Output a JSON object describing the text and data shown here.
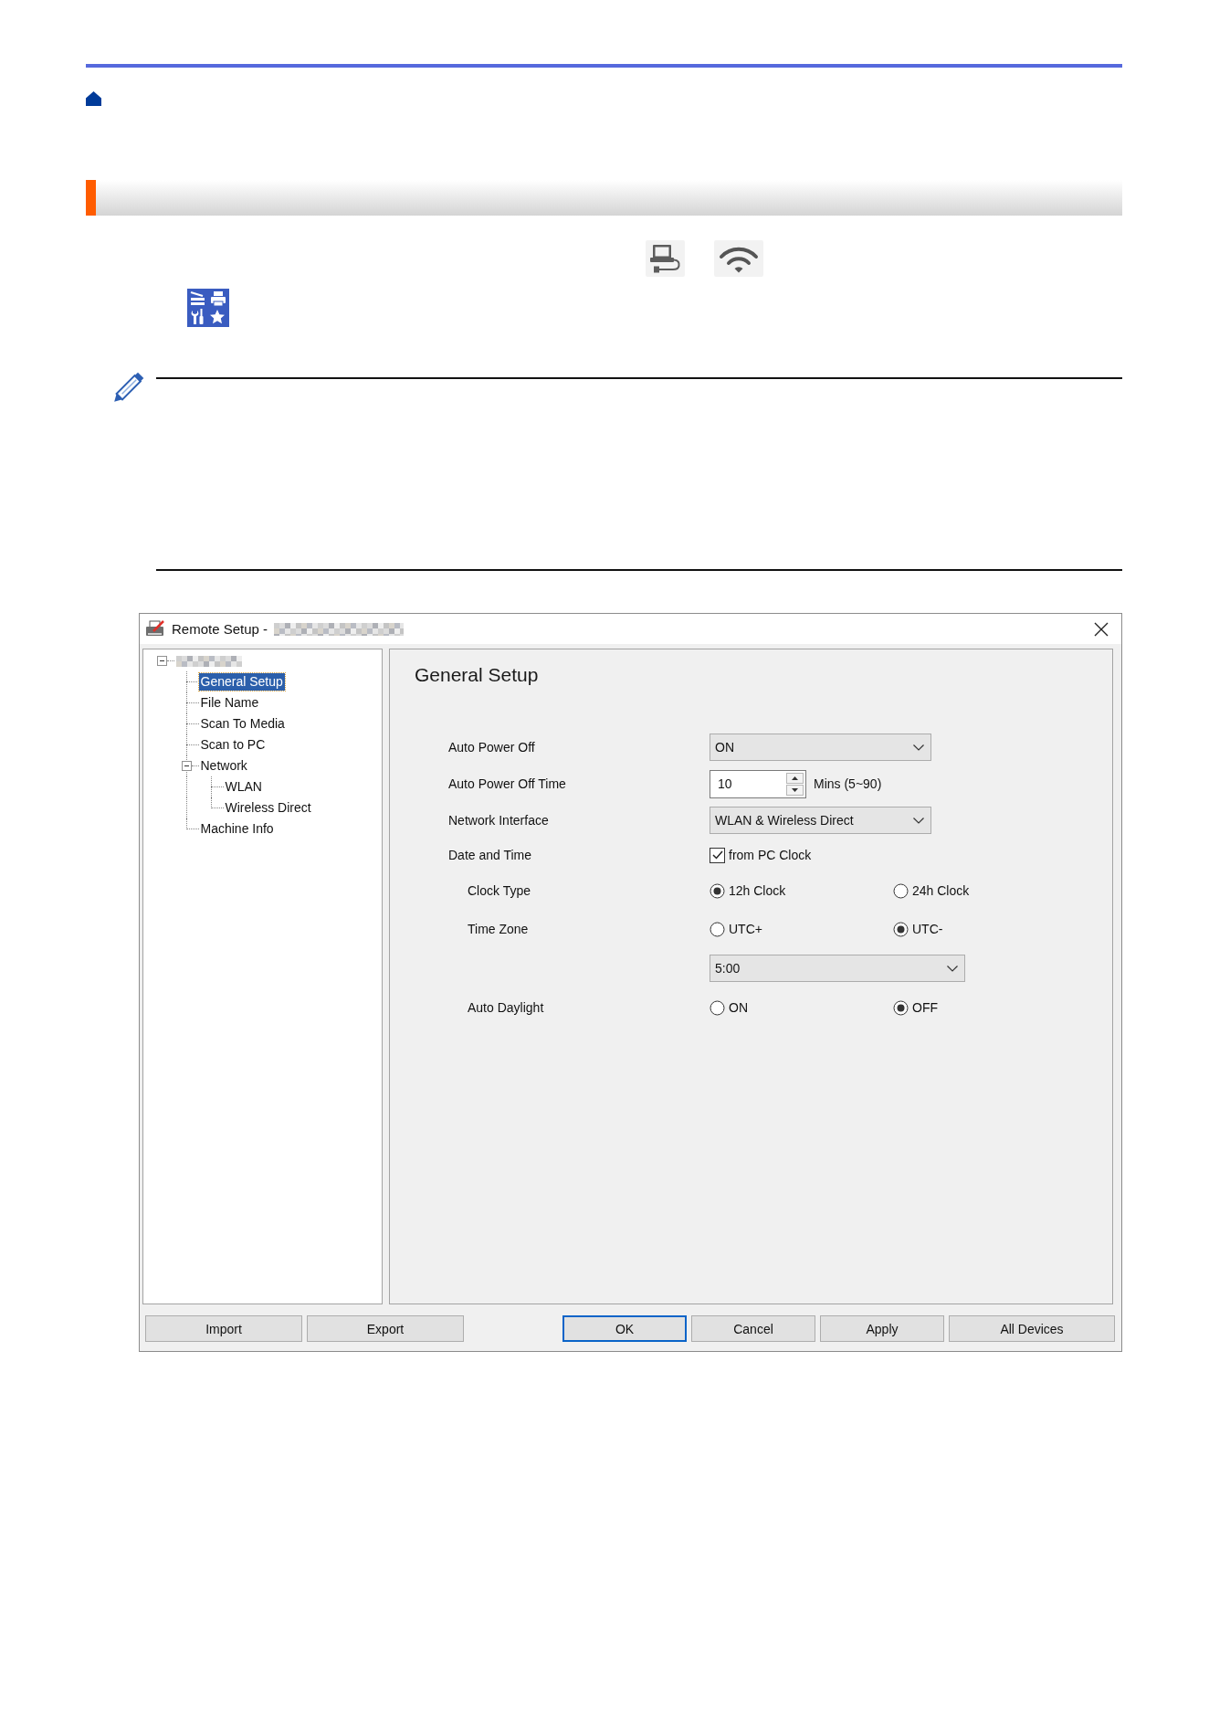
{
  "dialog": {
    "title": "Remote Setup -",
    "tree": {
      "selected": false,
      "expanded": true,
      "children": [
        {
          "label": "General Setup",
          "selected": true
        },
        {
          "label": "File Name",
          "selected": false
        },
        {
          "label": "Scan To Media",
          "selected": false
        },
        {
          "label": "Scan to PC",
          "selected": false
        },
        {
          "label": "Network",
          "selected": false,
          "expanded": true,
          "children": [
            {
              "label": "WLAN",
              "selected": false
            },
            {
              "label": "Wireless Direct",
              "selected": false
            }
          ]
        },
        {
          "label": "Machine Info",
          "selected": false
        }
      ]
    },
    "panel": {
      "title": "General Setup",
      "fields": [
        {
          "kind": "dropdown",
          "label": "Auto Power Off",
          "value": "ON"
        },
        {
          "kind": "spinner",
          "label": "Auto Power Off Time",
          "value": "10",
          "unit": "Mins (5~90)"
        },
        {
          "kind": "dropdown",
          "label": "Network Interface",
          "value": "WLAN & Wireless Direct"
        },
        {
          "kind": "checkbox",
          "label": "Date and Time",
          "option": "from PC Clock",
          "checked": true,
          "children": [
            {
              "kind": "radio",
              "label": "Clock Type",
              "options": [
                {
                  "label": "12h Clock",
                  "selected": true
                },
                {
                  "label": "24h Clock",
                  "selected": false
                }
              ]
            },
            {
              "kind": "radio",
              "label": "Time Zone",
              "options": [
                {
                  "label": "UTC+",
                  "selected": false
                },
                {
                  "label": "UTC-",
                  "selected": true
                }
              ],
              "dropdown": "5:00"
            },
            {
              "kind": "radio",
              "label": "Auto Daylight",
              "options": [
                {
                  "label": "ON",
                  "selected": false
                },
                {
                  "label": "OFF",
                  "selected": true
                }
              ]
            }
          ]
        }
      ]
    },
    "left_buttons": [
      {
        "label": "Import",
        "default": false
      },
      {
        "label": "Export",
        "default": false
      }
    ],
    "right_buttons": [
      {
        "label": "OK",
        "default": true
      },
      {
        "label": "Cancel",
        "default": false
      },
      {
        "label": "Apply",
        "default": false
      },
      {
        "label": "All Devices",
        "default": false
      }
    ]
  }
}
